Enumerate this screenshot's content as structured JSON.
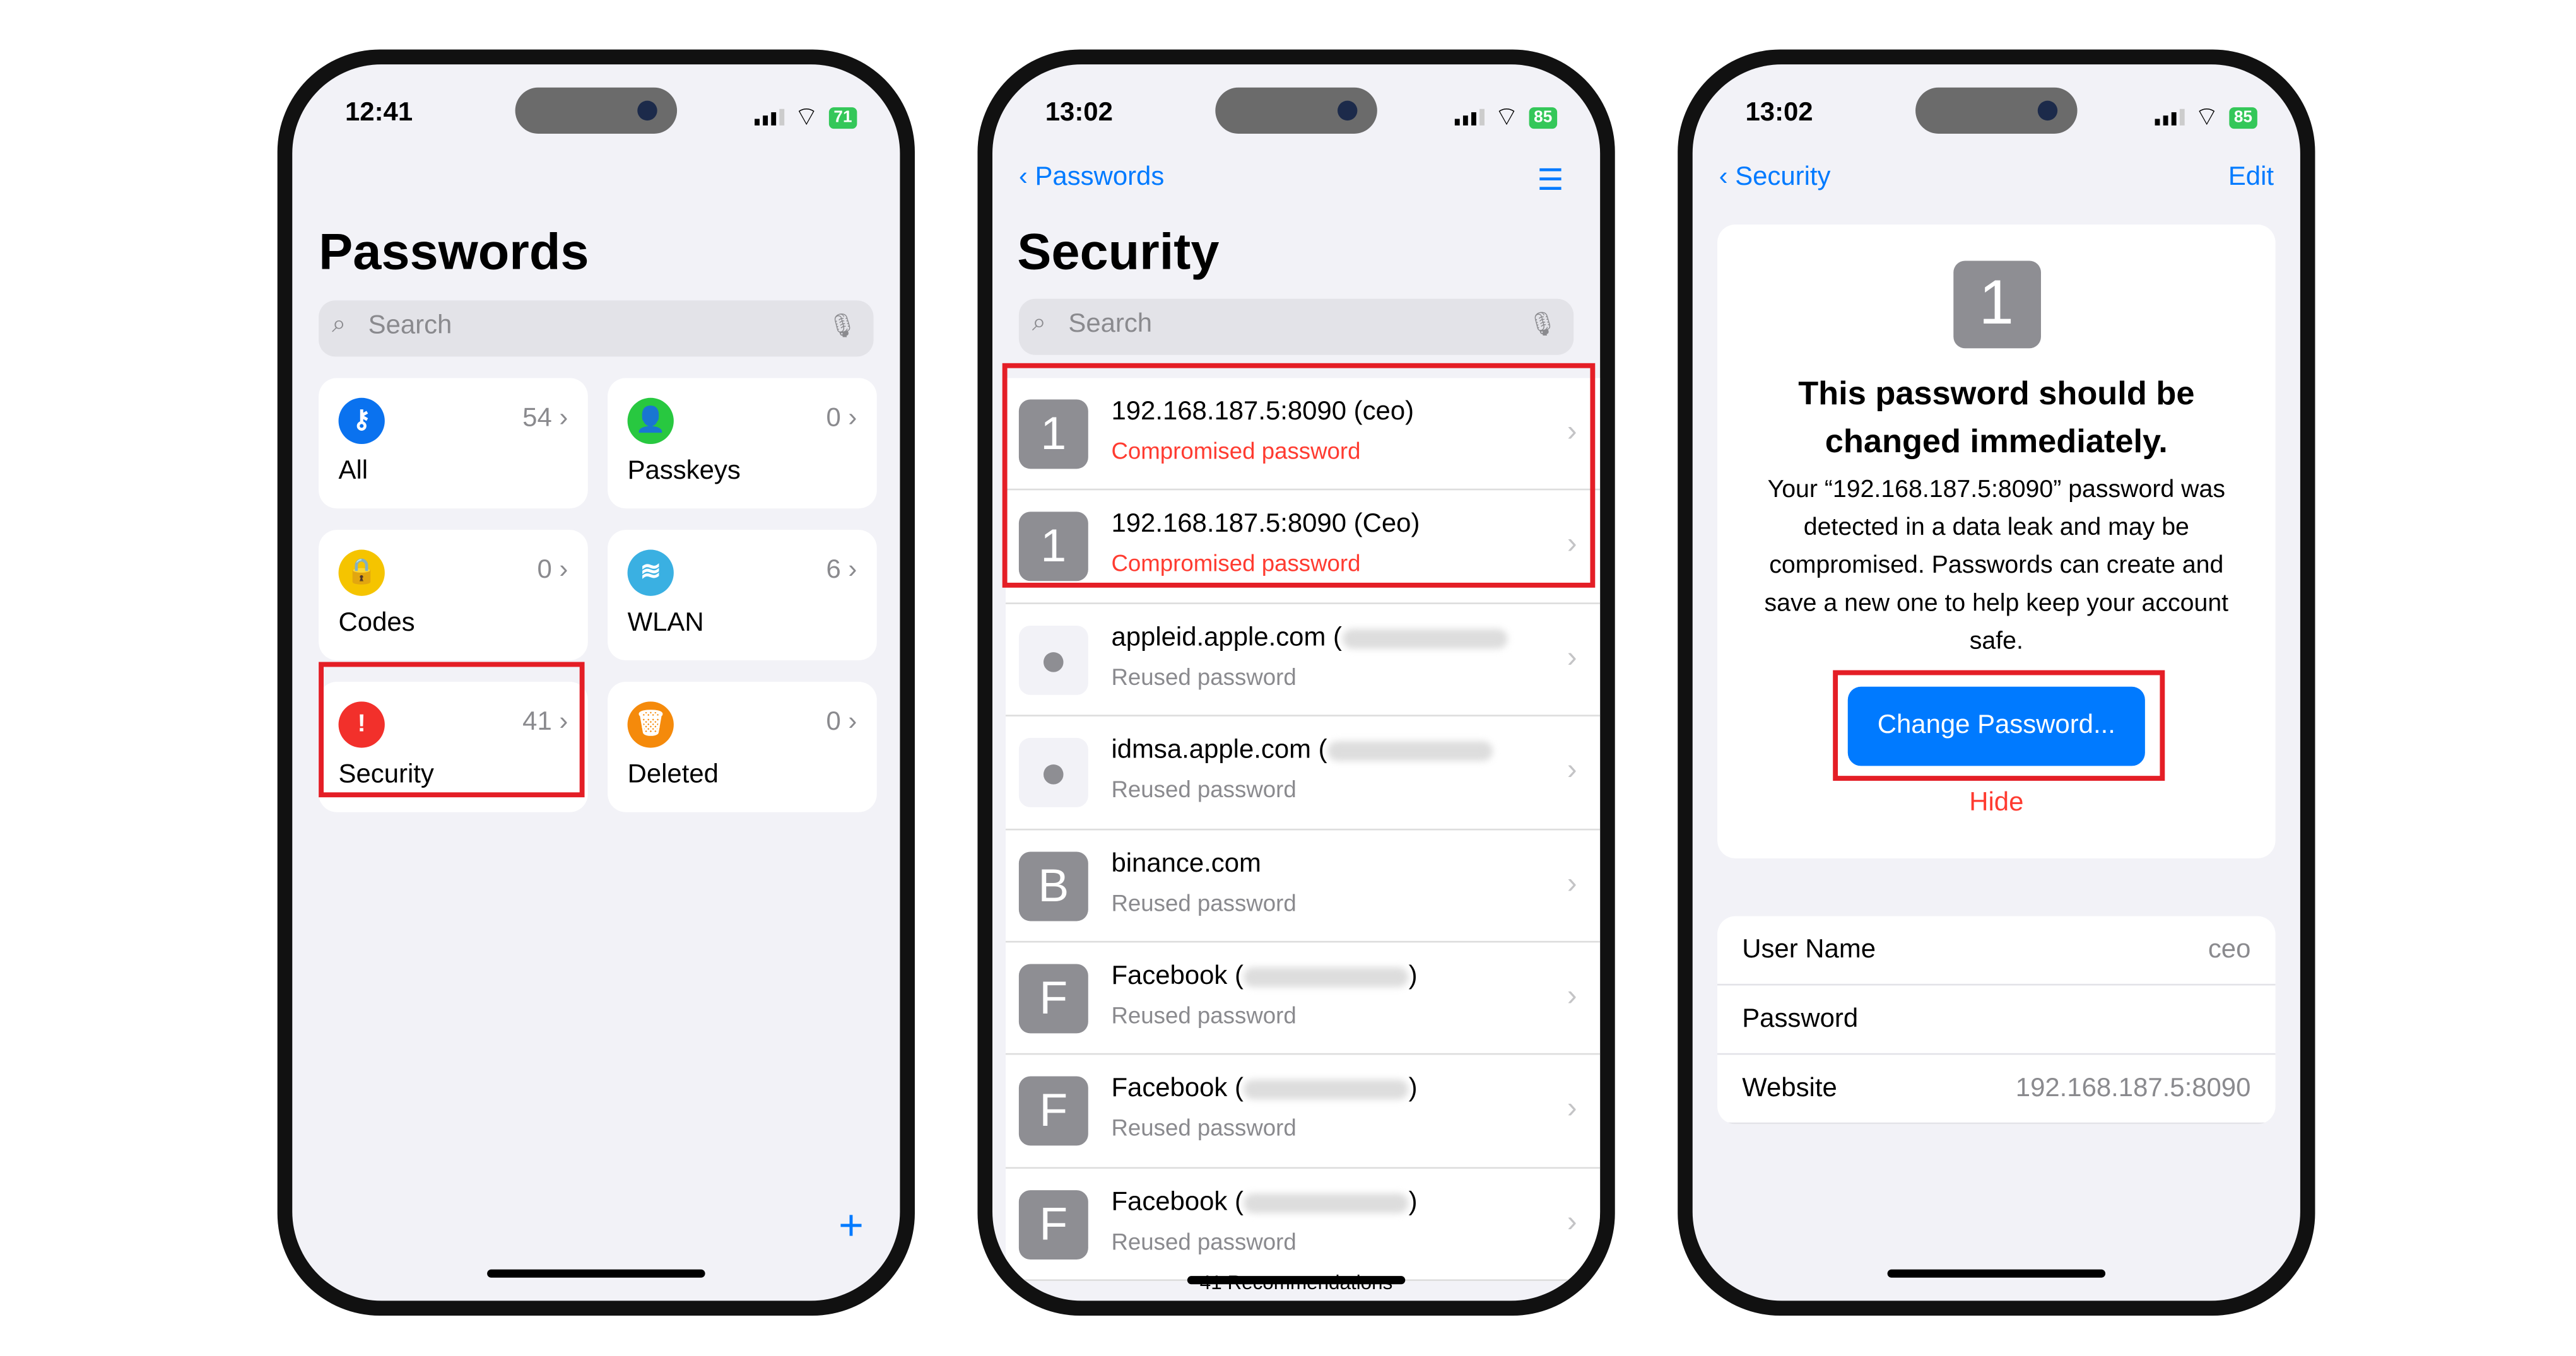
{
  "phones": [
    {
      "time": "12:41",
      "battery": "71",
      "title": "Passwords",
      "search_placeholder": "Search",
      "tiles": [
        {
          "label": "All",
          "count": "54",
          "icon": "key-icon",
          "color": "#0a72ef"
        },
        {
          "label": "Passkeys",
          "count": "0",
          "icon": "person-key-icon",
          "color": "#28c840"
        },
        {
          "label": "Codes",
          "count": "0",
          "icon": "lock-clock-icon",
          "color": "#f5c400"
        },
        {
          "label": "WLAN",
          "count": "6",
          "icon": "wifi-icon",
          "color": "#3ab0e2"
        },
        {
          "label": "Security",
          "count": "41",
          "icon": "exclamation-icon",
          "color": "#f2302b"
        },
        {
          "label": "Deleted",
          "count": "0",
          "icon": "trash-icon",
          "color": "#f58a0b"
        }
      ],
      "add_button": "+"
    },
    {
      "time": "13:02",
      "battery": "85",
      "back": "Passwords",
      "title": "Security",
      "search_placeholder": "Search",
      "items": [
        {
          "title": "192.168.187.5:8090 (ceo)",
          "subtitle": "Compromised password",
          "avatar": "1",
          "status": "bad"
        },
        {
          "title": "192.168.187.5:8090 (Ceo)",
          "subtitle": "Compromised password",
          "avatar": "1",
          "status": "bad"
        },
        {
          "title": "appleid.apple.com (",
          "subtitle": "Reused password",
          "avatar": "",
          "status": "reused"
        },
        {
          "title": "idmsa.apple.com (",
          "subtitle": "Reused password",
          "avatar": "",
          "status": "reused"
        },
        {
          "title": "binance.com",
          "subtitle": "Reused password",
          "avatar": "B",
          "status": "reused"
        },
        {
          "title": "Facebook (",
          "close": ")",
          "subtitle": "Reused password",
          "avatar": "F",
          "status": "reused"
        },
        {
          "title": "Facebook (",
          "close": ")",
          "subtitle": "Reused password",
          "avatar": "F",
          "status": "reused"
        },
        {
          "title": "Facebook (",
          "close": ")",
          "subtitle": "Reused password",
          "avatar": "F",
          "status": "reused"
        }
      ],
      "footer": "41 Recommendations"
    },
    {
      "time": "13:02",
      "battery": "85",
      "back": "Security",
      "edit": "Edit",
      "avatar": "1",
      "heading": "This password should be changed immediately.",
      "body": "Your “192.168.187.5:8090” password was detected in a data leak and may be compromised. Passwords can create and save a new one to help keep your account safe.",
      "change_button": "Change Password...",
      "hide": "Hide",
      "fields": [
        {
          "label": "User Name",
          "value": "ceo"
        },
        {
          "label": "Password",
          "value": ""
        },
        {
          "label": "Website",
          "value": "192.168.187.5:8090"
        }
      ]
    }
  ],
  "colors": {
    "accent": "#007aff",
    "highlight": "#e41e26",
    "danger": "#ff3b30"
  }
}
